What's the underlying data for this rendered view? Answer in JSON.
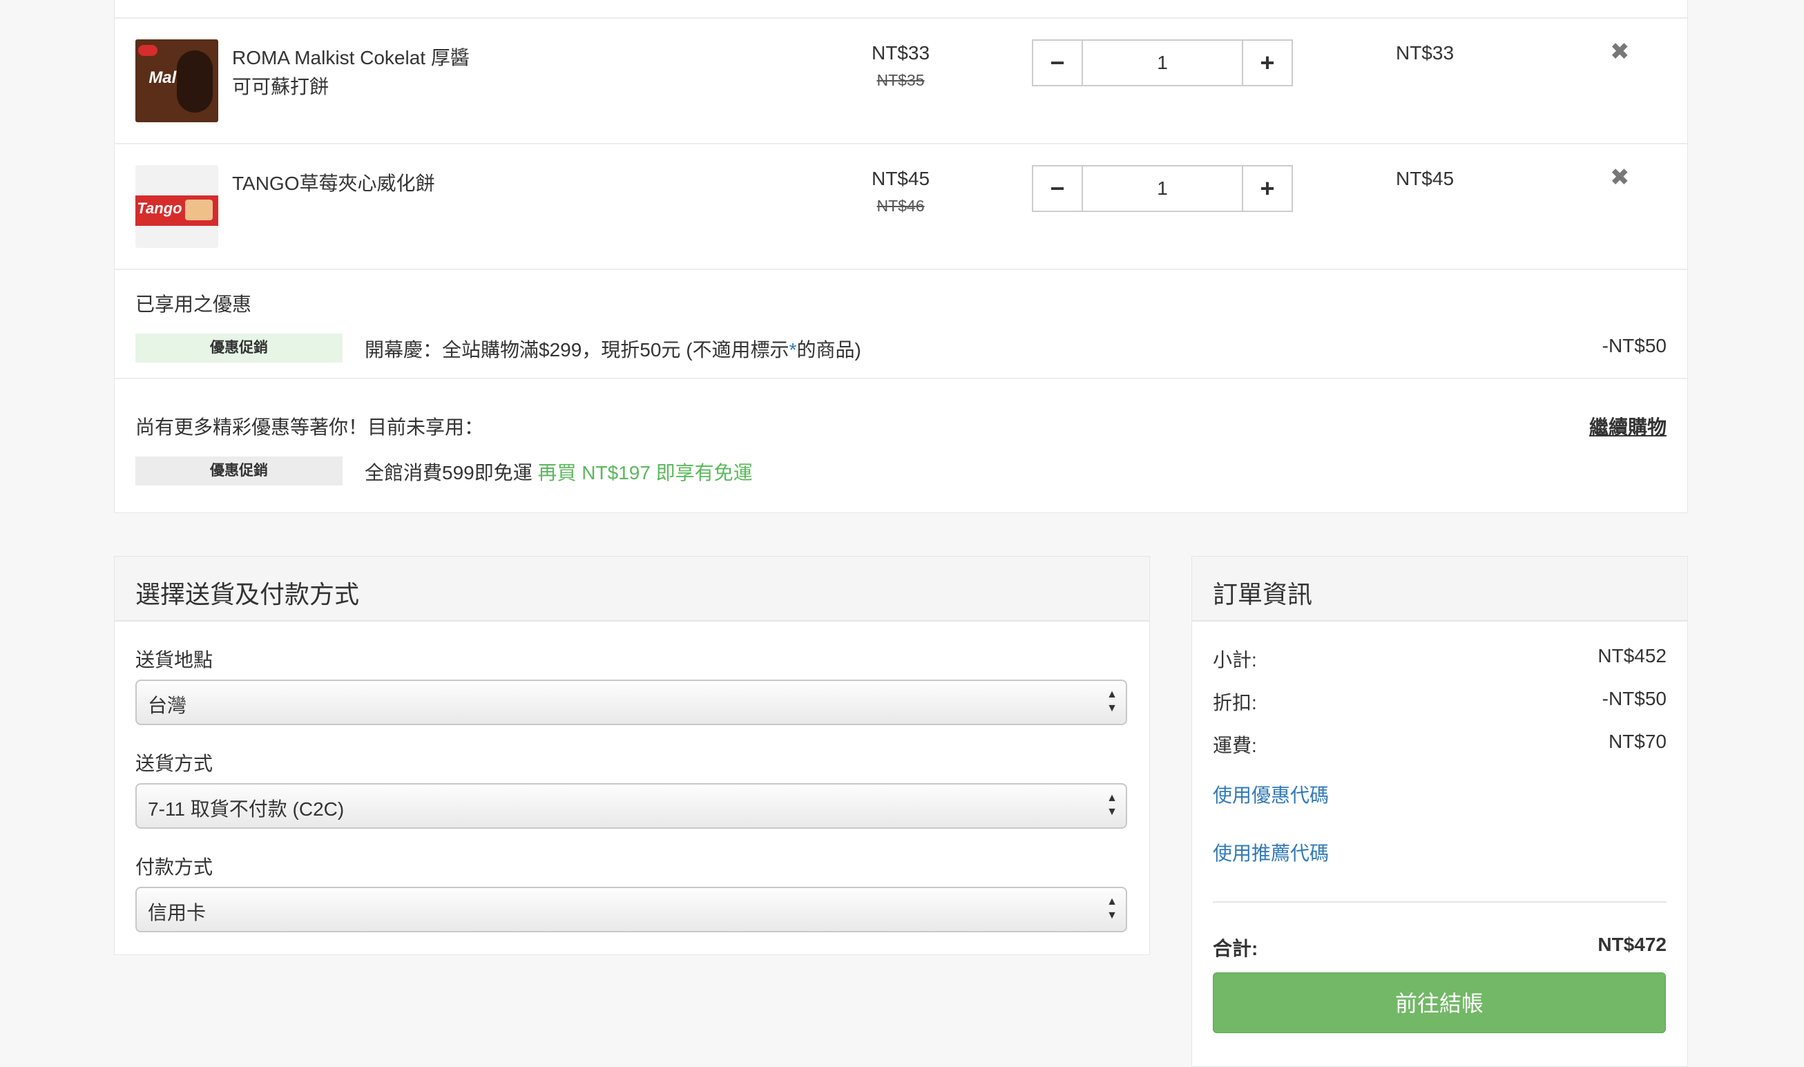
{
  "cart": {
    "items": [
      {
        "name_line1": "ROMA Malkist Cokelat 厚醬",
        "name_line2": "可可蘇打餅",
        "price": "NT$33",
        "old_price": "NT$35",
        "quantity": "1",
        "line_total": "NT$33",
        "thumb_brand": "Malkist",
        "thumb_color": "#5a2e18"
      },
      {
        "name_line1": "TANGO草莓夾心威化餅",
        "name_line2": "",
        "price": "NT$45",
        "old_price": "NT$46",
        "quantity": "1",
        "line_total": "NT$45",
        "thumb_brand": "Tango",
        "thumb_color": "#d62c2c"
      }
    ],
    "applied_promos": {
      "heading": "已享用之優惠",
      "badge": "優惠促銷",
      "text_before": "開幕慶：全站購物滿$299，現折50元 (不適用標示",
      "asterisk": "*",
      "text_after": "的商品)",
      "discount": "-NT$50"
    },
    "more_promos": {
      "heading": "尚有更多精彩優惠等著你！目前未享用：",
      "continue_shopping": "繼續購物",
      "badge": "優惠促銷",
      "text": "全館消費599即免運",
      "hint": "再買 NT$197 即享有免運"
    }
  },
  "delivery": {
    "title": "選擇送貨及付款方式",
    "location_label": "送貨地點",
    "location_value": "台灣",
    "method_label": "送貨方式",
    "method_value": "7-11 取貨不付款 (C2C)",
    "payment_label": "付款方式",
    "payment_value": "信用卡"
  },
  "order": {
    "title": "訂單資訊",
    "subtotal_label": "小計:",
    "subtotal_value": "NT$452",
    "discount_label": "折扣:",
    "discount_value": "-NT$50",
    "shipping_label": "運費:",
    "shipping_value": "NT$70",
    "coupon_link": "使用優惠代碼",
    "referral_link": "使用推薦代碼",
    "total_label": "合計:",
    "total_value": "NT$472",
    "checkout_button": "前往結帳"
  },
  "colors": {
    "accent_green": "#72b866",
    "link_blue": "#337ab7",
    "promo_green_text": "#5cb85c"
  }
}
